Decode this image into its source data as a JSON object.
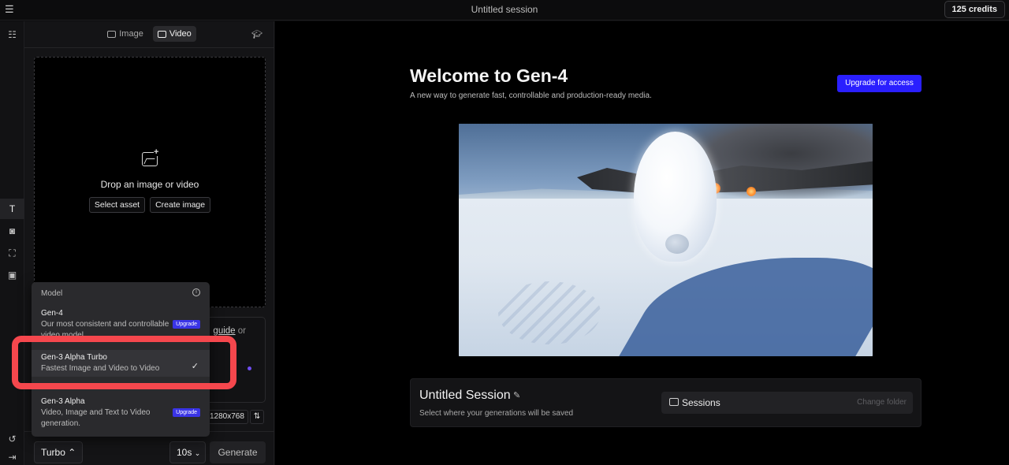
{
  "topbar": {
    "title": "Untitled session",
    "credits": "125 credits"
  },
  "rail": {
    "icons": [
      "sidebar-list-icon",
      "text-icon",
      "camera-icon",
      "face-scan-icon",
      "film-icon",
      "undo-icon",
      "collapse-icon"
    ]
  },
  "panel": {
    "modes": [
      {
        "label": "Image"
      },
      {
        "label": "Video"
      }
    ],
    "drop": {
      "text": "Drop an image or video",
      "select_asset": "Select asset",
      "create_image": "Create image"
    },
    "prompt_hint": {
      "prefix": "",
      "link": "guide",
      "suffix": "or"
    },
    "resolution": "1280x768",
    "bottom": {
      "model": "Turbo",
      "duration": "10s",
      "generate": "Generate"
    }
  },
  "dropdown": {
    "header": "Model",
    "options": [
      {
        "title": "Gen-4",
        "desc": "Our most consistent and controllable video model",
        "badge": "Upgrade"
      },
      {
        "title": "Gen-3 Alpha Turbo",
        "desc": "Fastest Image and Video to Video",
        "selected": true
      },
      {
        "title": "Gen-3 Alpha",
        "desc": "Video, Image and Text to Video generation.",
        "badge": "Upgrade"
      }
    ]
  },
  "main": {
    "welcome": "Welcome to Gen-4",
    "subtitle": "A new way to generate fast, controllable and production-ready media.",
    "upgrade": "Upgrade for access",
    "session": {
      "title": "Untitled Session",
      "desc": "Select where your generations will be saved",
      "folder_label": "Sessions",
      "change_folder": "Change folder"
    }
  },
  "colors": {
    "accent": "#2a1fff",
    "highlight": "#f5474d"
  }
}
